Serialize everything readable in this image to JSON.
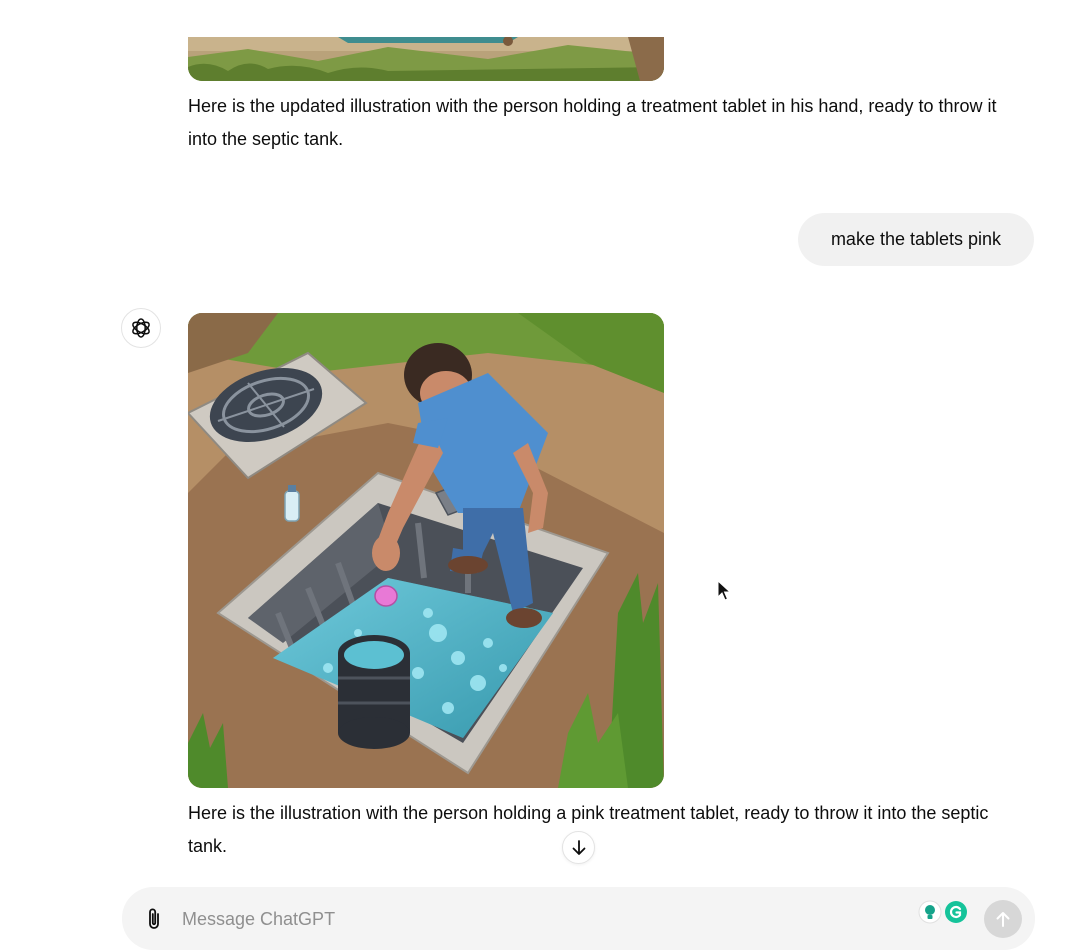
{
  "conversation": {
    "previous_reply_text": "Here is the updated illustration with the person holding a treatment tablet in his hand, ready to throw it into the septic tank.",
    "user_message": "make the tablets pink",
    "assistant_reply_text": "Here is the illustration with the person holding a pink treatment tablet, ready to throw it into the septic tank."
  },
  "icons": {
    "assistant_avatar": "openai-logo-icon",
    "scroll_down": "arrow-down-icon",
    "attach": "paperclip-icon",
    "send": "arrow-up-icon",
    "extensions": [
      "lightbulb-extension-icon",
      "grammarly-icon"
    ]
  },
  "composer": {
    "placeholder": "Message ChatGPT",
    "value": ""
  },
  "colors": {
    "user_bubble": "#f1f1f1",
    "composer_bg": "#f4f4f4",
    "send_disabled": "#d7d7d7",
    "grammarly_green": "#15c39a",
    "tablet_pink": "#e879d6",
    "water_teal": "#4fb3c8"
  }
}
